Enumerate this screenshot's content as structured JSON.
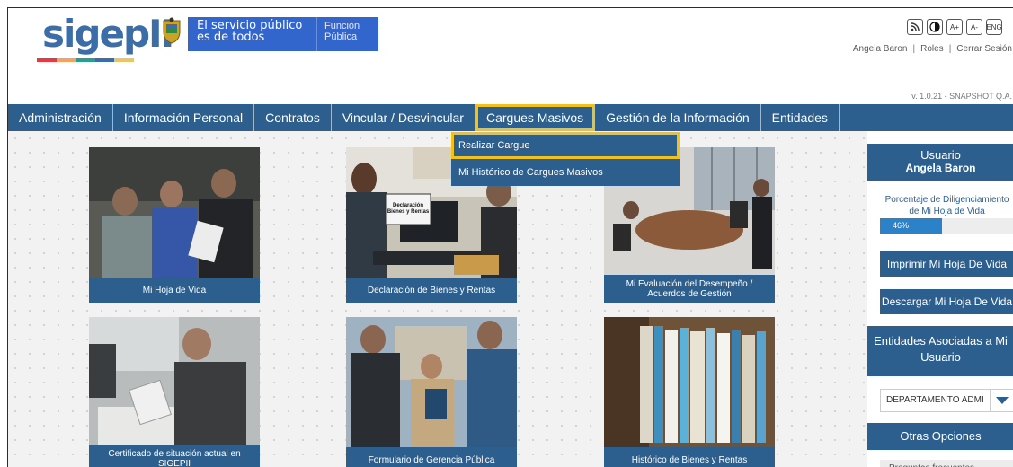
{
  "header": {
    "logo_text": "sigepII",
    "gov_line1": "El servicio público",
    "gov_line2": "es de todos",
    "func_line1": "Función",
    "func_line2": "Pública",
    "access_buttons": [
      "A+",
      "A-",
      "ENG"
    ],
    "user_name": "Angela Baron",
    "roles_link": "Roles",
    "logout_link": "Cerrar Sesión",
    "version": "v. 1.0.21 - SNAPSHOT Q.A."
  },
  "nav": {
    "items": [
      "Administración",
      "Información Personal",
      "Contratos",
      "Vincular / Desvincular",
      "Cargues Masivos",
      "Gestión de la Información",
      "Entidades"
    ]
  },
  "dropdown": {
    "items": [
      "Realizar Cargue",
      "Mi Histórico de Cargues Masivos"
    ]
  },
  "cards": [
    {
      "label": "Mi Hoja de Vida"
    },
    {
      "label": "Declaración de Bienes y Rentas",
      "sign": "Declaración Bienes y Rentas"
    },
    {
      "label": "Mi Evaluación del Desempeño / Acuerdos de Gestión"
    },
    {
      "label": "Certificado de situación actual en SIGEPII"
    },
    {
      "label": "Formulario de Gerencia Pública"
    },
    {
      "label": "Histórico de Bienes y Rentas"
    }
  ],
  "sidebar": {
    "user_title": "Usuario",
    "user_name": "Angela Baron",
    "progress_label": "Porcentaje de Diligenciamiento de Mi Hoja de Vida",
    "progress_value": 46,
    "progress_text": "46%",
    "print_button": "Imprimir Mi Hoja De Vida",
    "download_button": "Descargar Mi Hoja De Vida",
    "entities_title": "Entidades Asociadas a Mi Usuario",
    "entity_selected": "DEPARTAMENTO ADMI",
    "options_title": "Otras Opciones",
    "faq_link": "Preguntas frecuentes"
  },
  "colors": {
    "primary": "#2c5f8d",
    "highlight": "#f2c21b",
    "gov_blue": "#3366cc",
    "progress": "#2c82c9"
  }
}
